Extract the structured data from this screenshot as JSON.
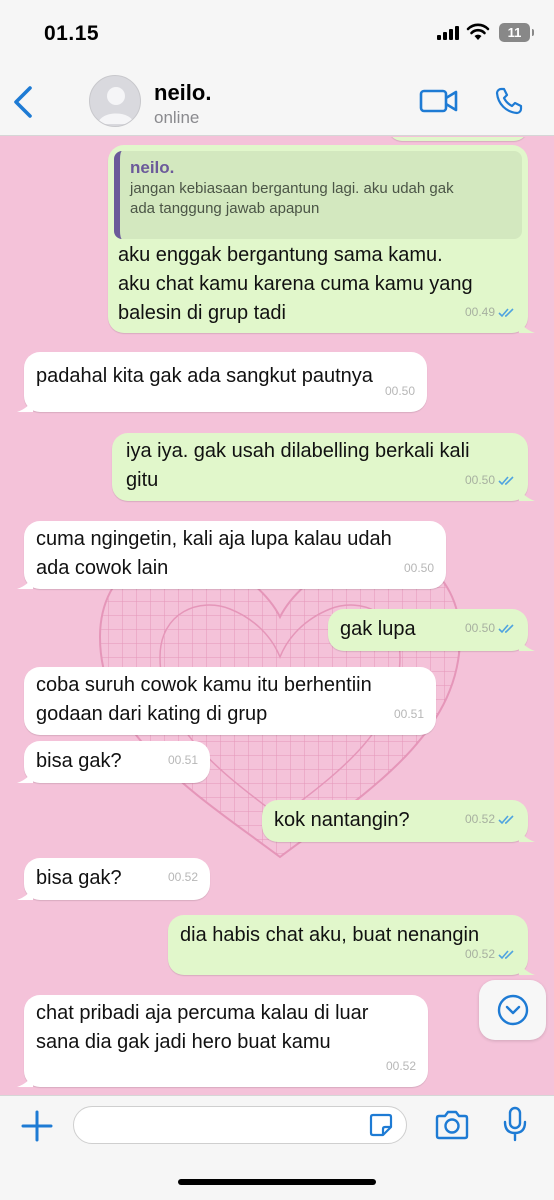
{
  "status_bar": {
    "time": "01.15",
    "battery": "11"
  },
  "header": {
    "contact_name": "neilo.",
    "contact_status": "online"
  },
  "messages": [
    {
      "direction": "out",
      "quote": {
        "author": "neilo.",
        "text": "jangan kebiasaan bergantung lagi. aku udah gak\nada tanggung jawab apapun"
      },
      "text": "aku enggak bergantung sama kamu.\naku chat kamu karena cuma kamu yang\nbalesin di grup tadi",
      "time": "00.49",
      "read": true
    },
    {
      "direction": "in",
      "text": "padahal kita gak ada sangkut pautnya",
      "time": "00.50"
    },
    {
      "direction": "out",
      "text": "iya iya. gak usah dilabelling berkali kali\ngitu",
      "time": "00.50",
      "read": true
    },
    {
      "direction": "in",
      "text": "cuma ngingetin, kali aja lupa kalau udah\nada cowok lain",
      "time": "00.50"
    },
    {
      "direction": "out",
      "text": "gak lupa",
      "time": "00.50",
      "read": true
    },
    {
      "direction": "in",
      "text": "coba suruh cowok kamu itu berhentiin\ngodaan dari kating di grup",
      "time": "00.51"
    },
    {
      "direction": "in",
      "text": "bisa gak?",
      "time": "00.51"
    },
    {
      "direction": "out",
      "text": "kok nantangin?",
      "time": "00.52",
      "read": true
    },
    {
      "direction": "in",
      "text": "bisa gak?",
      "time": "00.52"
    },
    {
      "direction": "out",
      "text": "dia habis chat aku, buat nenangin",
      "time": "00.52",
      "read": true
    },
    {
      "direction": "in",
      "text": "chat pribadi aja percuma kalau di luar\nsana dia gak jadi hero buat kamu",
      "time": "00.52"
    }
  ],
  "input": {
    "value": ""
  },
  "colors": {
    "chat_background": "#f4c2d9",
    "outgoing_bubble": "#e1f7cb",
    "incoming_bubble": "#ffffff",
    "accent": "#1e7bd4",
    "read_ticks": "#4fa3e0"
  },
  "icons": [
    "back-chevron-icon",
    "avatar-placeholder-icon",
    "video-call-icon",
    "phone-icon",
    "plus-icon",
    "sticker-icon",
    "camera-icon",
    "microphone-icon",
    "chevron-down-icon",
    "read-ticks-icon"
  ]
}
